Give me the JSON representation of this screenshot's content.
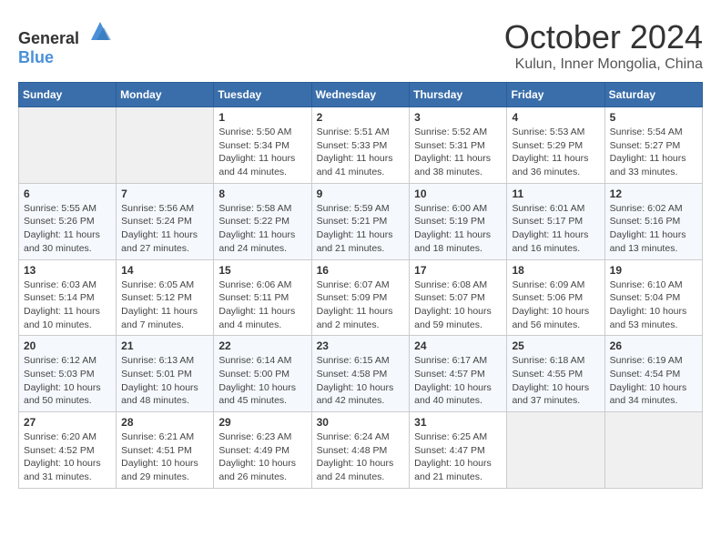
{
  "header": {
    "logo_general": "General",
    "logo_blue": "Blue",
    "title": "October 2024",
    "subtitle": "Kulun, Inner Mongolia, China"
  },
  "weekdays": [
    "Sunday",
    "Monday",
    "Tuesday",
    "Wednesday",
    "Thursday",
    "Friday",
    "Saturday"
  ],
  "weeks": [
    [
      {
        "day": "",
        "detail": ""
      },
      {
        "day": "",
        "detail": ""
      },
      {
        "day": "1",
        "detail": "Sunrise: 5:50 AM\nSunset: 5:34 PM\nDaylight: 11 hours and 44 minutes."
      },
      {
        "day": "2",
        "detail": "Sunrise: 5:51 AM\nSunset: 5:33 PM\nDaylight: 11 hours and 41 minutes."
      },
      {
        "day": "3",
        "detail": "Sunrise: 5:52 AM\nSunset: 5:31 PM\nDaylight: 11 hours and 38 minutes."
      },
      {
        "day": "4",
        "detail": "Sunrise: 5:53 AM\nSunset: 5:29 PM\nDaylight: 11 hours and 36 minutes."
      },
      {
        "day": "5",
        "detail": "Sunrise: 5:54 AM\nSunset: 5:27 PM\nDaylight: 11 hours and 33 minutes."
      }
    ],
    [
      {
        "day": "6",
        "detail": "Sunrise: 5:55 AM\nSunset: 5:26 PM\nDaylight: 11 hours and 30 minutes."
      },
      {
        "day": "7",
        "detail": "Sunrise: 5:56 AM\nSunset: 5:24 PM\nDaylight: 11 hours and 27 minutes."
      },
      {
        "day": "8",
        "detail": "Sunrise: 5:58 AM\nSunset: 5:22 PM\nDaylight: 11 hours and 24 minutes."
      },
      {
        "day": "9",
        "detail": "Sunrise: 5:59 AM\nSunset: 5:21 PM\nDaylight: 11 hours and 21 minutes."
      },
      {
        "day": "10",
        "detail": "Sunrise: 6:00 AM\nSunset: 5:19 PM\nDaylight: 11 hours and 18 minutes."
      },
      {
        "day": "11",
        "detail": "Sunrise: 6:01 AM\nSunset: 5:17 PM\nDaylight: 11 hours and 16 minutes."
      },
      {
        "day": "12",
        "detail": "Sunrise: 6:02 AM\nSunset: 5:16 PM\nDaylight: 11 hours and 13 minutes."
      }
    ],
    [
      {
        "day": "13",
        "detail": "Sunrise: 6:03 AM\nSunset: 5:14 PM\nDaylight: 11 hours and 10 minutes."
      },
      {
        "day": "14",
        "detail": "Sunrise: 6:05 AM\nSunset: 5:12 PM\nDaylight: 11 hours and 7 minutes."
      },
      {
        "day": "15",
        "detail": "Sunrise: 6:06 AM\nSunset: 5:11 PM\nDaylight: 11 hours and 4 minutes."
      },
      {
        "day": "16",
        "detail": "Sunrise: 6:07 AM\nSunset: 5:09 PM\nDaylight: 11 hours and 2 minutes."
      },
      {
        "day": "17",
        "detail": "Sunrise: 6:08 AM\nSunset: 5:07 PM\nDaylight: 10 hours and 59 minutes."
      },
      {
        "day": "18",
        "detail": "Sunrise: 6:09 AM\nSunset: 5:06 PM\nDaylight: 10 hours and 56 minutes."
      },
      {
        "day": "19",
        "detail": "Sunrise: 6:10 AM\nSunset: 5:04 PM\nDaylight: 10 hours and 53 minutes."
      }
    ],
    [
      {
        "day": "20",
        "detail": "Sunrise: 6:12 AM\nSunset: 5:03 PM\nDaylight: 10 hours and 50 minutes."
      },
      {
        "day": "21",
        "detail": "Sunrise: 6:13 AM\nSunset: 5:01 PM\nDaylight: 10 hours and 48 minutes."
      },
      {
        "day": "22",
        "detail": "Sunrise: 6:14 AM\nSunset: 5:00 PM\nDaylight: 10 hours and 45 minutes."
      },
      {
        "day": "23",
        "detail": "Sunrise: 6:15 AM\nSunset: 4:58 PM\nDaylight: 10 hours and 42 minutes."
      },
      {
        "day": "24",
        "detail": "Sunrise: 6:17 AM\nSunset: 4:57 PM\nDaylight: 10 hours and 40 minutes."
      },
      {
        "day": "25",
        "detail": "Sunrise: 6:18 AM\nSunset: 4:55 PM\nDaylight: 10 hours and 37 minutes."
      },
      {
        "day": "26",
        "detail": "Sunrise: 6:19 AM\nSunset: 4:54 PM\nDaylight: 10 hours and 34 minutes."
      }
    ],
    [
      {
        "day": "27",
        "detail": "Sunrise: 6:20 AM\nSunset: 4:52 PM\nDaylight: 10 hours and 31 minutes."
      },
      {
        "day": "28",
        "detail": "Sunrise: 6:21 AM\nSunset: 4:51 PM\nDaylight: 10 hours and 29 minutes."
      },
      {
        "day": "29",
        "detail": "Sunrise: 6:23 AM\nSunset: 4:49 PM\nDaylight: 10 hours and 26 minutes."
      },
      {
        "day": "30",
        "detail": "Sunrise: 6:24 AM\nSunset: 4:48 PM\nDaylight: 10 hours and 24 minutes."
      },
      {
        "day": "31",
        "detail": "Sunrise: 6:25 AM\nSunset: 4:47 PM\nDaylight: 10 hours and 21 minutes."
      },
      {
        "day": "",
        "detail": ""
      },
      {
        "day": "",
        "detail": ""
      }
    ]
  ]
}
